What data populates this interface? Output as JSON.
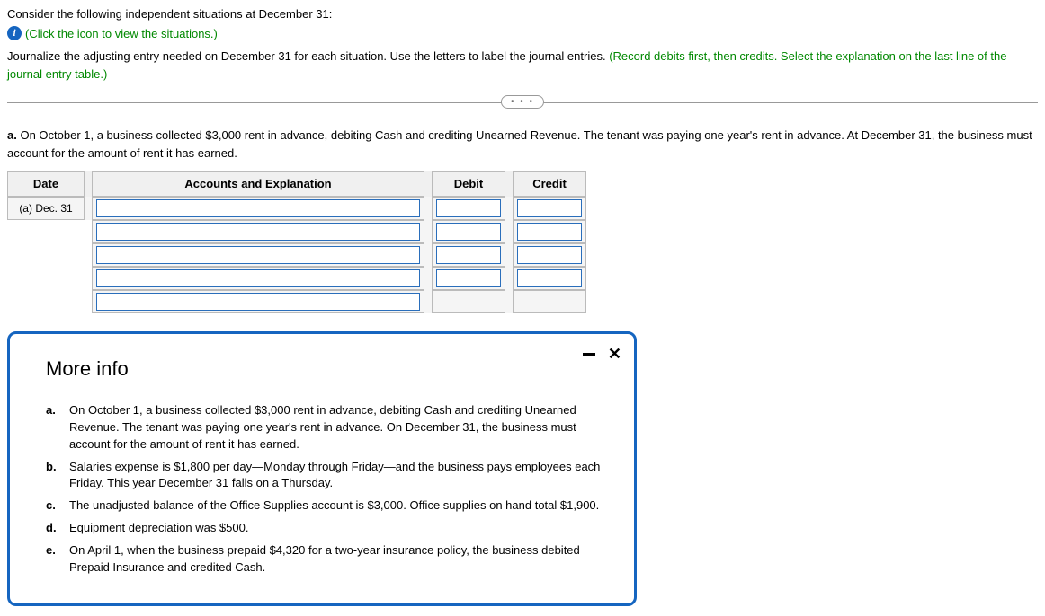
{
  "intro": {
    "line1": "Consider the following independent situations at December 31:",
    "link_text": "(Click the icon to view the situations.)",
    "instruct_black": "Journalize the adjusting entry needed on December 31 for each situation. Use the letters to label the journal entries. ",
    "instruct_green": "(Record debits first, then credits. Select the explanation on the last line of the journal entry table.)"
  },
  "dots": "• • •",
  "situation_a": {
    "label": "a.",
    "text": " On October 1, a business collected $3,000 rent in advance, debiting Cash and crediting Unearned Revenue. The tenant was paying one year's rent in advance. At December 31, the business must account for the amount of rent it has earned."
  },
  "table": {
    "headers": {
      "date": "Date",
      "acct": "Accounts and Explanation",
      "debit": "Debit",
      "credit": "Credit"
    },
    "date_value": "(a) Dec. 31"
  },
  "modal": {
    "title": "More info",
    "items": [
      {
        "label": "a.",
        "text": "On October 1, a business collected $3,000 rent in advance, debiting Cash and crediting Unearned Revenue. The tenant was paying one year's rent in advance. On December 31, the business must account for the amount of rent it has earned."
      },
      {
        "label": "b.",
        "text": "Salaries expense is $1,800 per day—Monday through Friday—and the business pays employees each Friday. This year December 31 falls on a Thursday."
      },
      {
        "label": "c.",
        "text": "The unadjusted balance of the Office Supplies account is $3,000. Office supplies on hand total $1,900."
      },
      {
        "label": "d.",
        "text": "Equipment depreciation was $500."
      },
      {
        "label": "e.",
        "text": "On April 1, when the business prepaid $4,320 for a two-year insurance policy, the business debited Prepaid Insurance and credited Cash."
      }
    ]
  }
}
